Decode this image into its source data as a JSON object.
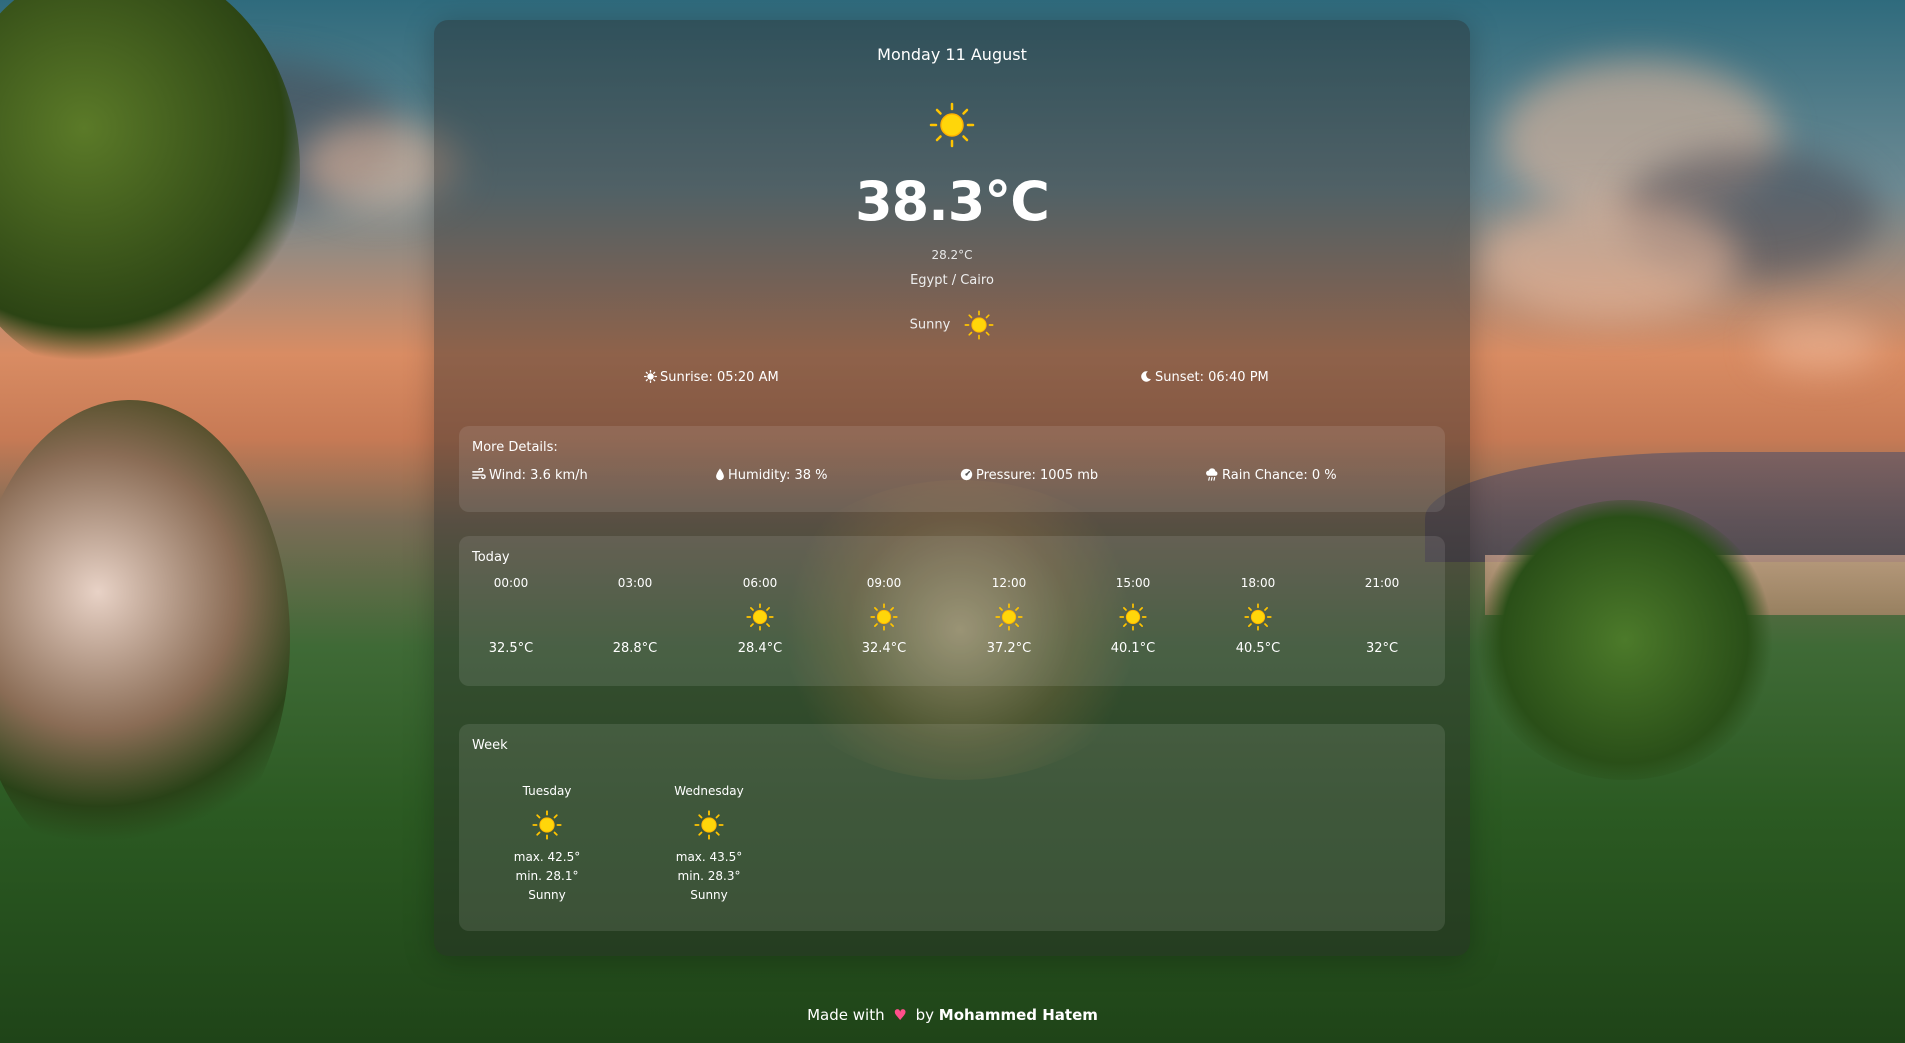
{
  "weather": {
    "date": "Monday 11 August",
    "temperature": "38.3°C",
    "feels_like": "28.2°C",
    "location": "Egypt / Cairo",
    "condition": "Sunny",
    "condition_icon": "sun-icon",
    "sunrise": "Sunrise: 05:20 AM",
    "sunset": "Sunset: 06:40 PM"
  },
  "details": {
    "title": "More Details:",
    "wind": "Wind: 3.6 km/h",
    "humidity": "Humidity: 38 %",
    "pressure": "Pressure: 1005 mb",
    "rain": "Rain Chance: 0 %"
  },
  "today": {
    "title": "Today",
    "hours": [
      {
        "time": "00:00",
        "temp": "32.5°C",
        "icon": "moon-icon"
      },
      {
        "time": "03:00",
        "temp": "28.8°C",
        "icon": "moon-icon"
      },
      {
        "time": "06:00",
        "temp": "28.4°C",
        "icon": "sun-icon"
      },
      {
        "time": "09:00",
        "temp": "32.4°C",
        "icon": "sun-icon"
      },
      {
        "time": "12:00",
        "temp": "37.2°C",
        "icon": "sun-icon"
      },
      {
        "time": "15:00",
        "temp": "40.1°C",
        "icon": "sun-icon"
      },
      {
        "time": "18:00",
        "temp": "40.5°C",
        "icon": "sun-icon"
      },
      {
        "time": "21:00",
        "temp": "32°C",
        "icon": "moon-icon"
      }
    ]
  },
  "week": {
    "title": "Week",
    "days": [
      {
        "name": "Tuesday",
        "max": "max. 42.5°",
        "min": "min. 28.1°",
        "condition": "Sunny",
        "icon": "sun-icon"
      },
      {
        "name": "Wednesday",
        "max": "max. 43.5°",
        "min": "min. 28.3°",
        "condition": "Sunny",
        "icon": "sun-icon"
      }
    ]
  },
  "footer": {
    "made_with": "Made with",
    "heart": "♥",
    "by": "by",
    "author": "Mohammed Hatem"
  },
  "colors": {
    "sun": "#ffc400",
    "sun_core": "#ffd60a",
    "moon": "#3f8cff",
    "heart": "#ff4f8b"
  }
}
